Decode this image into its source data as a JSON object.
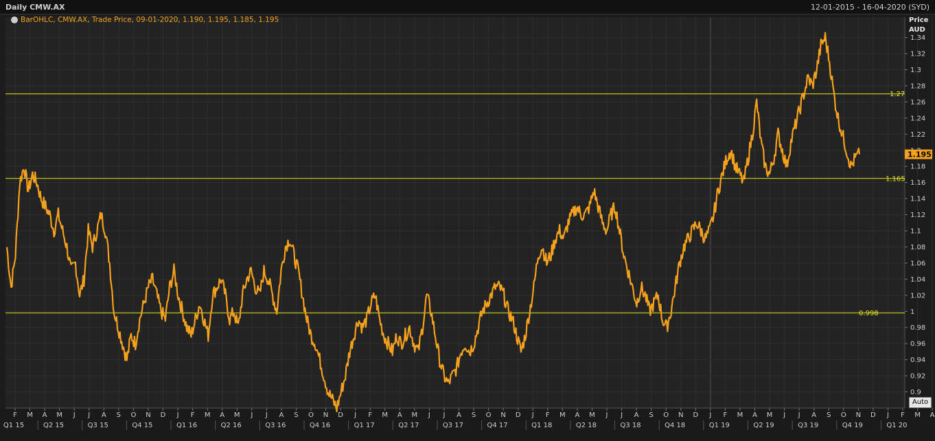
{
  "header": {
    "title": "Daily CMW.AX",
    "date_range": "12-01-2015 - 16-04-2020 (SYD)"
  },
  "legend": {
    "text": "BarOHLC, CMW.AX, Trade Price, 09-01-2020, 1.190, 1.195, 1.185, 1.195"
  },
  "auto_button": "Auto",
  "colors": {
    "series": "#f5a11c",
    "hline": "#e6e61a",
    "last_price_bg": "#f5a11c",
    "grid": "#2e2e2e"
  },
  "chart_data": {
    "type": "line",
    "series_name": "CMW.AX",
    "y_axis_header": [
      "Price",
      "AUD"
    ],
    "ylim": [
      0.88,
      1.355
    ],
    "y_ticks": [
      "0.9",
      "0.92",
      "0.94",
      "0.96",
      "0.98",
      "1",
      "1.02",
      "1.04",
      "1.06",
      "1.08",
      "1.1",
      "1.12",
      "1.14",
      "1.16",
      "1.18",
      "1.2",
      "1.22",
      "1.24",
      "1.26",
      "1.28",
      "1.3",
      "1.32",
      "1.34"
    ],
    "y_tick_values": [
      0.9,
      0.92,
      0.94,
      0.96,
      0.98,
      1.0,
      1.02,
      1.04,
      1.06,
      1.08,
      1.1,
      1.12,
      1.14,
      1.16,
      1.18,
      1.2,
      1.22,
      1.24,
      1.26,
      1.28,
      1.3,
      1.32,
      1.34
    ],
    "last_price": "1.195",
    "last_price_value": 1.195,
    "horizontal_lines": [
      {
        "label": "1.27",
        "value": 1.27
      },
      {
        "label": "1.165",
        "value": 1.165
      },
      {
        "label": "0.998",
        "value": 0.998
      }
    ],
    "x_month_ticks": [
      "F",
      "M",
      "A",
      "M",
      "J",
      "J",
      "A",
      "S",
      "O",
      "N",
      "D",
      "J",
      "F",
      "M",
      "A",
      "M",
      "J",
      "J",
      "A",
      "S",
      "O",
      "N",
      "D",
      "J",
      "F",
      "M",
      "A",
      "M",
      "J",
      "J",
      "A",
      "S",
      "O",
      "N",
      "D",
      "J",
      "F",
      "M",
      "A",
      "M",
      "J",
      "J",
      "A",
      "S",
      "O",
      "N",
      "D",
      "J",
      "F",
      "M",
      "A",
      "M",
      "J",
      "J",
      "A",
      "S",
      "O",
      "N",
      "D",
      "J",
      "F",
      "M",
      "A"
    ],
    "x_quarter_ticks": [
      "Q1 15",
      "Q2 15",
      "Q3 15",
      "Q4 15",
      "Q1 16",
      "Q2 16",
      "Q3 16",
      "Q4 16",
      "Q1 17",
      "Q2 17",
      "Q3 17",
      "Q4 17",
      "Q1 18",
      "Q2 18",
      "Q3 18",
      "Q4 18",
      "Q1 19",
      "Q2 19",
      "Q3 19",
      "Q4 19",
      "Q1 20"
    ],
    "x_start": "2015-01-12",
    "x_end": "2020-04-16",
    "values": [
      1.08,
      1.03,
      1.07,
      1.16,
      1.18,
      1.15,
      1.17,
      1.16,
      1.14,
      1.13,
      1.12,
      1.1,
      1.12,
      1.1,
      1.08,
      1.05,
      1.06,
      1.02,
      1.04,
      1.1,
      1.08,
      1.1,
      1.12,
      1.1,
      1.06,
      1.0,
      0.98,
      0.96,
      0.94,
      0.97,
      0.96,
      0.99,
      1.01,
      1.03,
      1.04,
      1.02,
      1.0,
      0.99,
      1.03,
      1.05,
      1.02,
      1.0,
      0.98,
      0.97,
      0.99,
      1.01,
      0.99,
      0.97,
      1.02,
      1.03,
      1.04,
      1.02,
      0.99,
      1.0,
      0.98,
      1.02,
      1.04,
      1.05,
      1.03,
      1.02,
      1.05,
      1.04,
      1.02,
      1.0,
      1.05,
      1.08,
      1.09,
      1.07,
      1.05,
      1.02,
      0.99,
      0.97,
      0.96,
      0.94,
      0.92,
      0.9,
      0.89,
      0.88,
      0.9,
      0.92,
      0.95,
      0.97,
      0.99,
      0.98,
      0.99,
      1.01,
      1.02,
      0.99,
      0.97,
      0.96,
      0.95,
      0.97,
      0.96,
      0.97,
      0.98,
      0.96,
      0.95,
      0.98,
      1.02,
      1.0,
      0.97,
      0.94,
      0.92,
      0.91,
      0.92,
      0.93,
      0.95,
      0.96,
      0.95,
      0.96,
      0.98,
      1.0,
      1.01,
      1.02,
      1.03,
      1.03,
      1.02,
      1.0,
      0.99,
      0.97,
      0.95,
      0.97,
      1.0,
      1.03,
      1.07,
      1.08,
      1.06,
      1.07,
      1.09,
      1.1,
      1.09,
      1.11,
      1.12,
      1.13,
      1.12,
      1.12,
      1.13,
      1.15,
      1.13,
      1.11,
      1.1,
      1.12,
      1.13,
      1.1,
      1.07,
      1.05,
      1.03,
      1.01,
      1.03,
      1.02,
      1.0,
      1.01,
      1.02,
      0.99,
      0.98,
      1.0,
      1.03,
      1.06,
      1.08,
      1.09,
      1.1,
      1.11,
      1.1,
      1.09,
      1.1,
      1.12,
      1.15,
      1.17,
      1.19,
      1.2,
      1.18,
      1.17,
      1.16,
      1.19,
      1.22,
      1.26,
      1.21,
      1.18,
      1.17,
      1.19,
      1.22,
      1.2,
      1.18,
      1.21,
      1.23,
      1.25,
      1.27,
      1.29,
      1.28,
      1.3,
      1.33,
      1.34,
      1.31,
      1.27,
      1.24,
      1.22,
      1.2,
      1.18,
      1.19,
      1.195
    ]
  }
}
